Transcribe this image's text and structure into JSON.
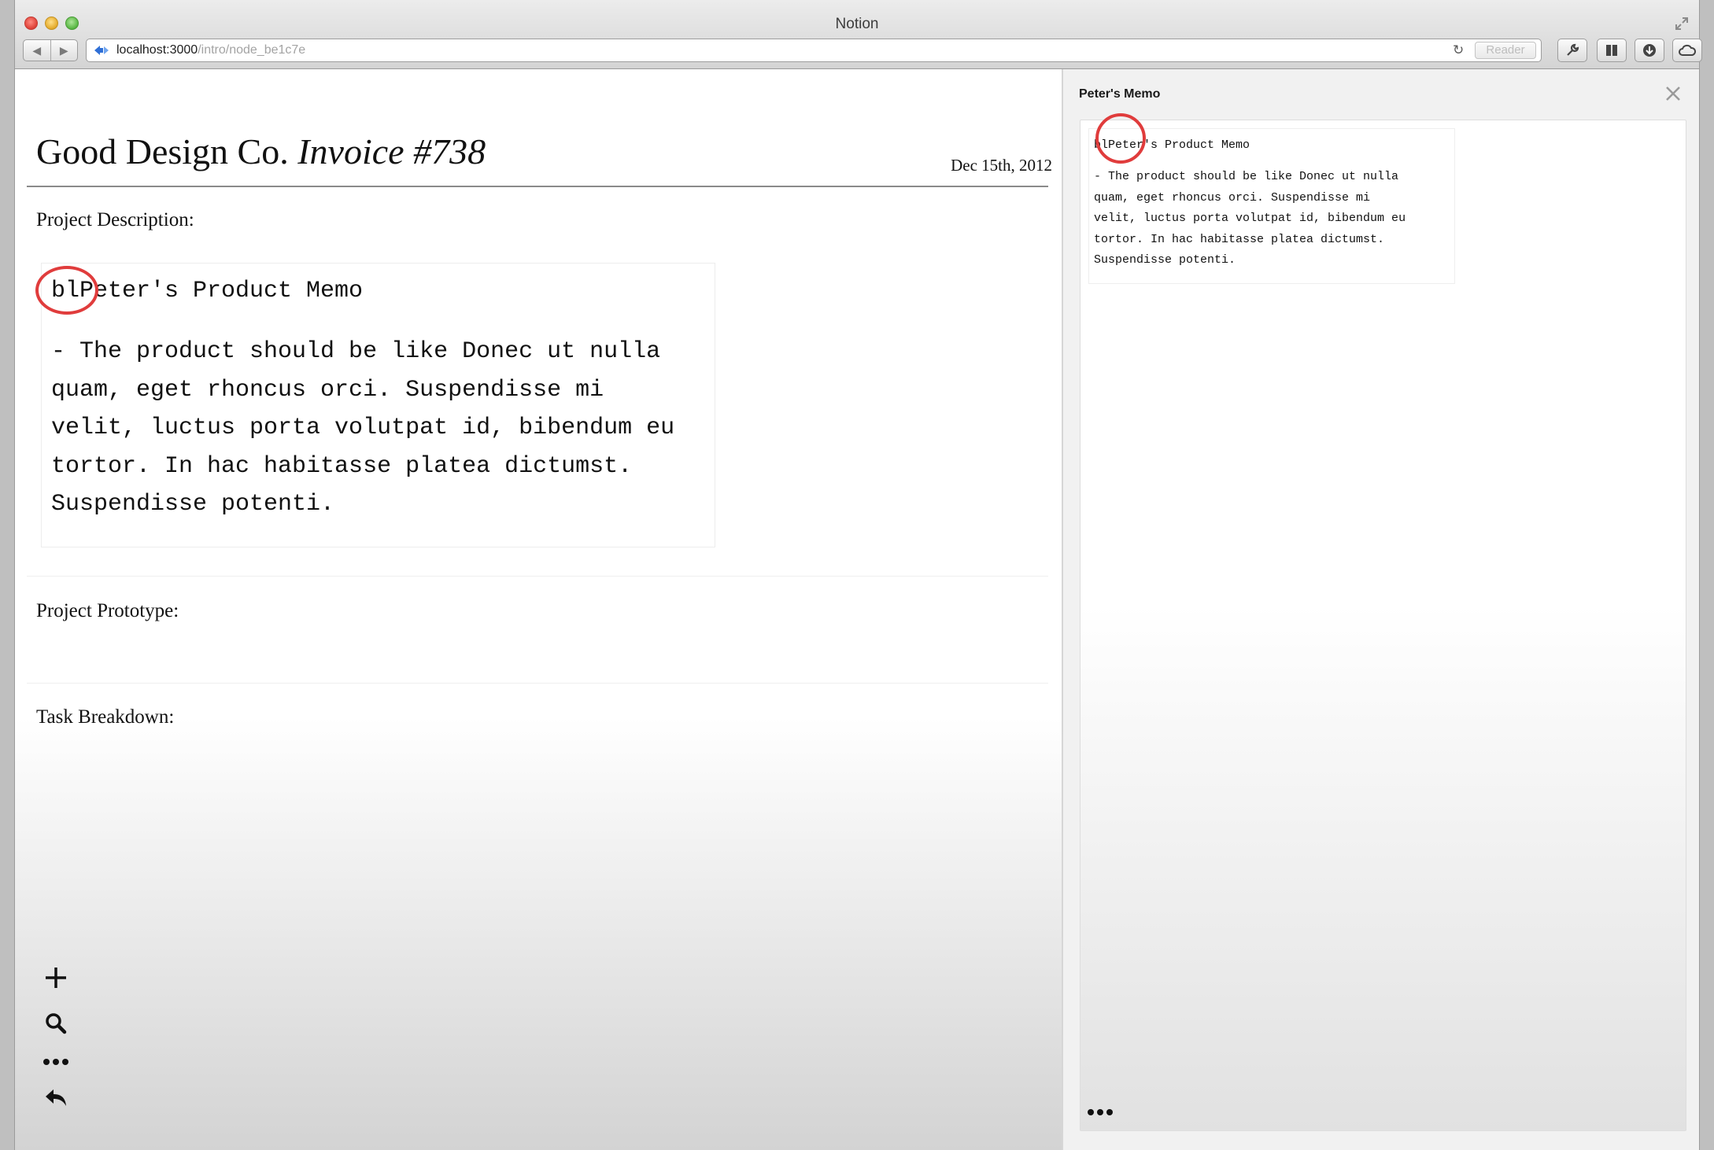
{
  "window": {
    "title": "Notion",
    "url_host": "localhost:3000",
    "url_path": "/intro/node_be1c7e",
    "reader_label": "Reader"
  },
  "document": {
    "title_plain": "Good Design Co.",
    "title_italic": "Invoice #738",
    "date": "Dec 15th, 2012",
    "sections": {
      "description_label": "Project Description:",
      "prototype_label": "Project Prototype:",
      "tasks_label": "Task Breakdown:"
    },
    "memo": {
      "heading": "blPeter's Product Memo",
      "body": "- The product should be like Donec ut nulla\nquam, eget rhoncus orci. Suspendisse mi\nvelit, luctus porta volutpat id, bibendum eu\ntortor. In hac habitasse platea dictumst.\nSuspendisse potenti."
    }
  },
  "left_toolbar": {
    "icons": [
      "plus-icon",
      "search-icon",
      "more-icon",
      "undo-arrow-icon"
    ]
  },
  "side_panel": {
    "title": "Peter's Memo",
    "memo": {
      "heading": "blPeter's Product Memo",
      "body": "- The product should be like Donec ut nulla\nquam, eget rhoncus orci. Suspendisse mi\nvelit, luctus porta volutpat id, bibendum eu\ntortor. In hac habitasse platea dictumst.\nSuspendisse potenti."
    }
  },
  "colors": {
    "annotation_circle": "#e03c3c",
    "text": "#111111"
  }
}
